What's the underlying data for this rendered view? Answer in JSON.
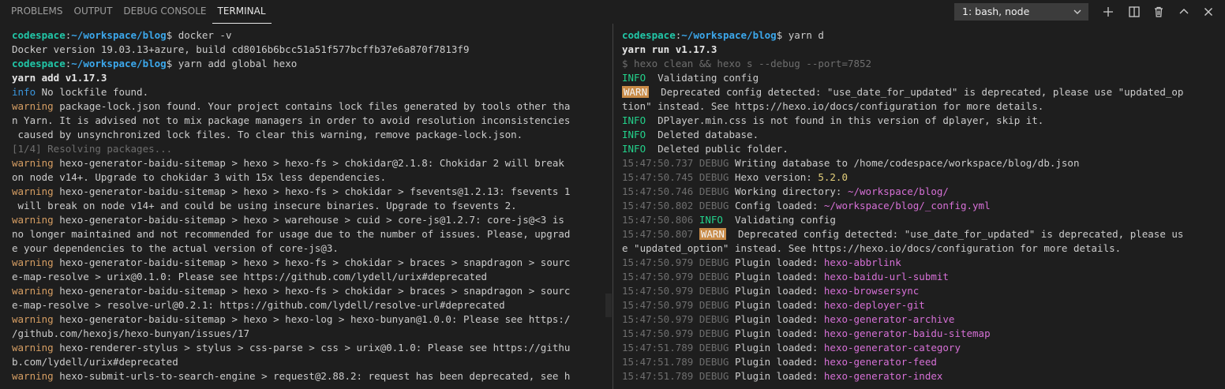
{
  "tabs": [
    {
      "label": "PROBLEMS",
      "active": false
    },
    {
      "label": "OUTPUT",
      "active": false
    },
    {
      "label": "DEBUG CONSOLE",
      "active": false
    },
    {
      "label": "TERMINAL",
      "active": true
    }
  ],
  "terminal_selector": {
    "value": "1: bash, node"
  },
  "actions": [
    "plus-icon",
    "split-icon",
    "trash-icon",
    "chevron-up-icon",
    "close-icon"
  ],
  "colors": {
    "background": "#1e1e1e",
    "prompt_host": "#21c7a8",
    "prompt_path": "#3ca8ec",
    "info": "#3a96dd",
    "warning": "#d69e63",
    "plugin": "#d670d6",
    "value": "#e5d07b"
  },
  "left_terminal": [
    [
      {
        "t": "codespace",
        "s": "host"
      },
      {
        "t": ":",
        "s": ""
      },
      {
        "t": "~/workspace/blog",
        "s": "path"
      },
      {
        "t": "$ docker -v",
        "s": ""
      }
    ],
    [
      {
        "t": "Docker version 19.03.13+azure, build cd8016b6bcc51a51f577bcffb37e6a870f7813f9",
        "s": ""
      }
    ],
    [
      {
        "t": "codespace",
        "s": "host"
      },
      {
        "t": ":",
        "s": ""
      },
      {
        "t": "~/workspace/blog",
        "s": "path"
      },
      {
        "t": "$ yarn add global hexo",
        "s": ""
      }
    ],
    [
      {
        "t": "yarn add v1.17.3",
        "s": "bold"
      }
    ],
    [
      {
        "t": "info",
        "s": "info"
      },
      {
        "t": " No lockfile found.",
        "s": ""
      }
    ],
    [
      {
        "t": "warning",
        "s": "warn"
      },
      {
        "t": " package-lock.json found. Your project contains lock files generated by tools other tha",
        "s": ""
      }
    ],
    [
      {
        "t": "n Yarn. It is advised not to mix package managers in order to avoid resolution inconsistencies",
        "s": ""
      }
    ],
    [
      {
        "t": " caused by unsynchronized lock files. To clear this warning, remove package-lock.json.",
        "s": ""
      }
    ],
    [
      {
        "t": "[1/4] Resolving packages...",
        "s": "gray"
      }
    ],
    [
      {
        "t": "warning",
        "s": "warn"
      },
      {
        "t": " hexo-generator-baidu-sitemap > hexo > hexo-fs > chokidar@2.1.8: Chokidar 2 will break",
        "s": ""
      }
    ],
    [
      {
        "t": "on node v14+. Upgrade to chokidar 3 with 15x less dependencies.",
        "s": ""
      }
    ],
    [
      {
        "t": "warning",
        "s": "warn"
      },
      {
        "t": " hexo-generator-baidu-sitemap > hexo > hexo-fs > chokidar > fsevents@1.2.13: fsevents 1",
        "s": ""
      }
    ],
    [
      {
        "t": " will break on node v14+ and could be using insecure binaries. Upgrade to fsevents 2.",
        "s": ""
      }
    ],
    [
      {
        "t": "warning",
        "s": "warn"
      },
      {
        "t": " hexo-generator-baidu-sitemap > hexo > warehouse > cuid > core-js@1.2.7: core-js@<3 is",
        "s": ""
      }
    ],
    [
      {
        "t": "no longer maintained and not recommended for usage due to the number of issues. Please, upgrad",
        "s": ""
      }
    ],
    [
      {
        "t": "e your dependencies to the actual version of core-js@3.",
        "s": ""
      }
    ],
    [
      {
        "t": "warning",
        "s": "warn"
      },
      {
        "t": " hexo-generator-baidu-sitemap > hexo > hexo-fs > chokidar > braces > snapdragon > sourc",
        "s": ""
      }
    ],
    [
      {
        "t": "e-map-resolve > urix@0.1.0: Please see https://github.com/lydell/urix#deprecated",
        "s": ""
      }
    ],
    [
      {
        "t": "warning",
        "s": "warn"
      },
      {
        "t": " hexo-generator-baidu-sitemap > hexo > hexo-fs > chokidar > braces > snapdragon > sourc",
        "s": ""
      }
    ],
    [
      {
        "t": "e-map-resolve > resolve-url@0.2.1: https://github.com/lydell/resolve-url#deprecated",
        "s": ""
      }
    ],
    [
      {
        "t": "warning",
        "s": "warn"
      },
      {
        "t": " hexo-generator-baidu-sitemap > hexo > hexo-log > hexo-bunyan@1.0.0: Please see https:/",
        "s": ""
      }
    ],
    [
      {
        "t": "/github.com/hexojs/hexo-bunyan/issues/17",
        "s": ""
      }
    ],
    [
      {
        "t": "warning",
        "s": "warn"
      },
      {
        "t": " hexo-renderer-stylus > stylus > css-parse > css > urix@0.1.0: Please see https://githu",
        "s": ""
      }
    ],
    [
      {
        "t": "b.com/lydell/urix#deprecated",
        "s": ""
      }
    ],
    [
      {
        "t": "warning",
        "s": "warn"
      },
      {
        "t": " hexo-submit-urls-to-search-engine > request@2.88.2: request has been deprecated, see h",
        "s": ""
      }
    ]
  ],
  "right_terminal": [
    [
      {
        "t": "codespace",
        "s": "host"
      },
      {
        "t": ":",
        "s": ""
      },
      {
        "t": "~/workspace/blog",
        "s": "path"
      },
      {
        "t": "$ yarn d",
        "s": ""
      }
    ],
    [
      {
        "t": "yarn run v1.17.3",
        "s": "bold"
      }
    ],
    [
      {
        "t": "$ hexo clean && hexo s --debug --port=7852",
        "s": "gray"
      }
    ],
    [
      {
        "t": "INFO",
        "s": "ginfo"
      },
      {
        "t": "  Validating config",
        "s": ""
      }
    ],
    [
      {
        "t": "WARN",
        "s": "badge"
      },
      {
        "t": "  Deprecated config detected: \"use_date_for_updated\" is deprecated, please use \"updated_op",
        "s": ""
      }
    ],
    [
      {
        "t": "tion\" instead. See https://hexo.io/docs/configuration for more details.",
        "s": ""
      }
    ],
    [
      {
        "t": "INFO",
        "s": "ginfo"
      },
      {
        "t": "  DPlayer.min.css is not found in this version of dplayer, skip it.",
        "s": ""
      }
    ],
    [
      {
        "t": "INFO",
        "s": "ginfo"
      },
      {
        "t": "  Deleted database.",
        "s": ""
      }
    ],
    [
      {
        "t": "INFO",
        "s": "ginfo"
      },
      {
        "t": "  Deleted public folder.",
        "s": ""
      }
    ],
    [
      {
        "t": "15:47:50.737 DEBUG",
        "s": "gray"
      },
      {
        "t": " Writing database to /home/codespace/workspace/blog/db.json",
        "s": ""
      }
    ],
    [
      {
        "t": "15:47:50.745 DEBUG",
        "s": "gray"
      },
      {
        "t": " Hexo version: ",
        "s": ""
      },
      {
        "t": "5.2.0",
        "s": "yel"
      }
    ],
    [
      {
        "t": "15:47:50.746 DEBUG",
        "s": "gray"
      },
      {
        "t": " Working directory: ",
        "s": ""
      },
      {
        "t": "~/workspace/blog/",
        "s": "mag"
      }
    ],
    [
      {
        "t": "15:47:50.802 DEBUG",
        "s": "gray"
      },
      {
        "t": " Config loaded: ",
        "s": ""
      },
      {
        "t": "~/workspace/blog/_config.yml",
        "s": "mag"
      }
    ],
    [
      {
        "t": "15:47:50.806 ",
        "s": "gray"
      },
      {
        "t": "INFO",
        "s": "ginfo"
      },
      {
        "t": "  Validating config",
        "s": ""
      }
    ],
    [
      {
        "t": "15:47:50.807 ",
        "s": "gray"
      },
      {
        "t": "WARN",
        "s": "badge"
      },
      {
        "t": "  Deprecated config detected: \"use_date_for_updated\" is deprecated, please us",
        "s": ""
      }
    ],
    [
      {
        "t": "e \"updated_option\"",
        "s": ""
      },
      {
        "t": " instead. See https://hexo.io/docs/configuration for more details.",
        "s": ""
      }
    ],
    [
      {
        "t": "15:47:50.979 DEBUG",
        "s": "gray"
      },
      {
        "t": " Plugin loaded: ",
        "s": ""
      },
      {
        "t": "hexo-abbrlink",
        "s": "mag"
      }
    ],
    [
      {
        "t": "15:47:50.979 DEBUG",
        "s": "gray"
      },
      {
        "t": " Plugin loaded: ",
        "s": ""
      },
      {
        "t": "hexo-baidu-url-submit",
        "s": "mag"
      }
    ],
    [
      {
        "t": "15:47:50.979 DEBUG",
        "s": "gray"
      },
      {
        "t": " Plugin loaded: ",
        "s": ""
      },
      {
        "t": "hexo-browsersync",
        "s": "mag"
      }
    ],
    [
      {
        "t": "15:47:50.979 DEBUG",
        "s": "gray"
      },
      {
        "t": " Plugin loaded: ",
        "s": ""
      },
      {
        "t": "hexo-deployer-git",
        "s": "mag"
      }
    ],
    [
      {
        "t": "15:47:50.979 DEBUG",
        "s": "gray"
      },
      {
        "t": " Plugin loaded: ",
        "s": ""
      },
      {
        "t": "hexo-generator-archive",
        "s": "mag"
      }
    ],
    [
      {
        "t": "15:47:50.979 DEBUG",
        "s": "gray"
      },
      {
        "t": " Plugin loaded: ",
        "s": ""
      },
      {
        "t": "hexo-generator-baidu-sitemap",
        "s": "mag"
      }
    ],
    [
      {
        "t": "15:47:51.789 DEBUG",
        "s": "gray"
      },
      {
        "t": " Plugin loaded: ",
        "s": ""
      },
      {
        "t": "hexo-generator-category",
        "s": "mag"
      }
    ],
    [
      {
        "t": "15:47:51.789 DEBUG",
        "s": "gray"
      },
      {
        "t": " Plugin loaded: ",
        "s": ""
      },
      {
        "t": "hexo-generator-feed",
        "s": "mag"
      }
    ],
    [
      {
        "t": "15:47:51.789 DEBUG",
        "s": "gray"
      },
      {
        "t": " Plugin loaded: ",
        "s": ""
      },
      {
        "t": "hexo-generator-index",
        "s": "mag"
      }
    ]
  ]
}
